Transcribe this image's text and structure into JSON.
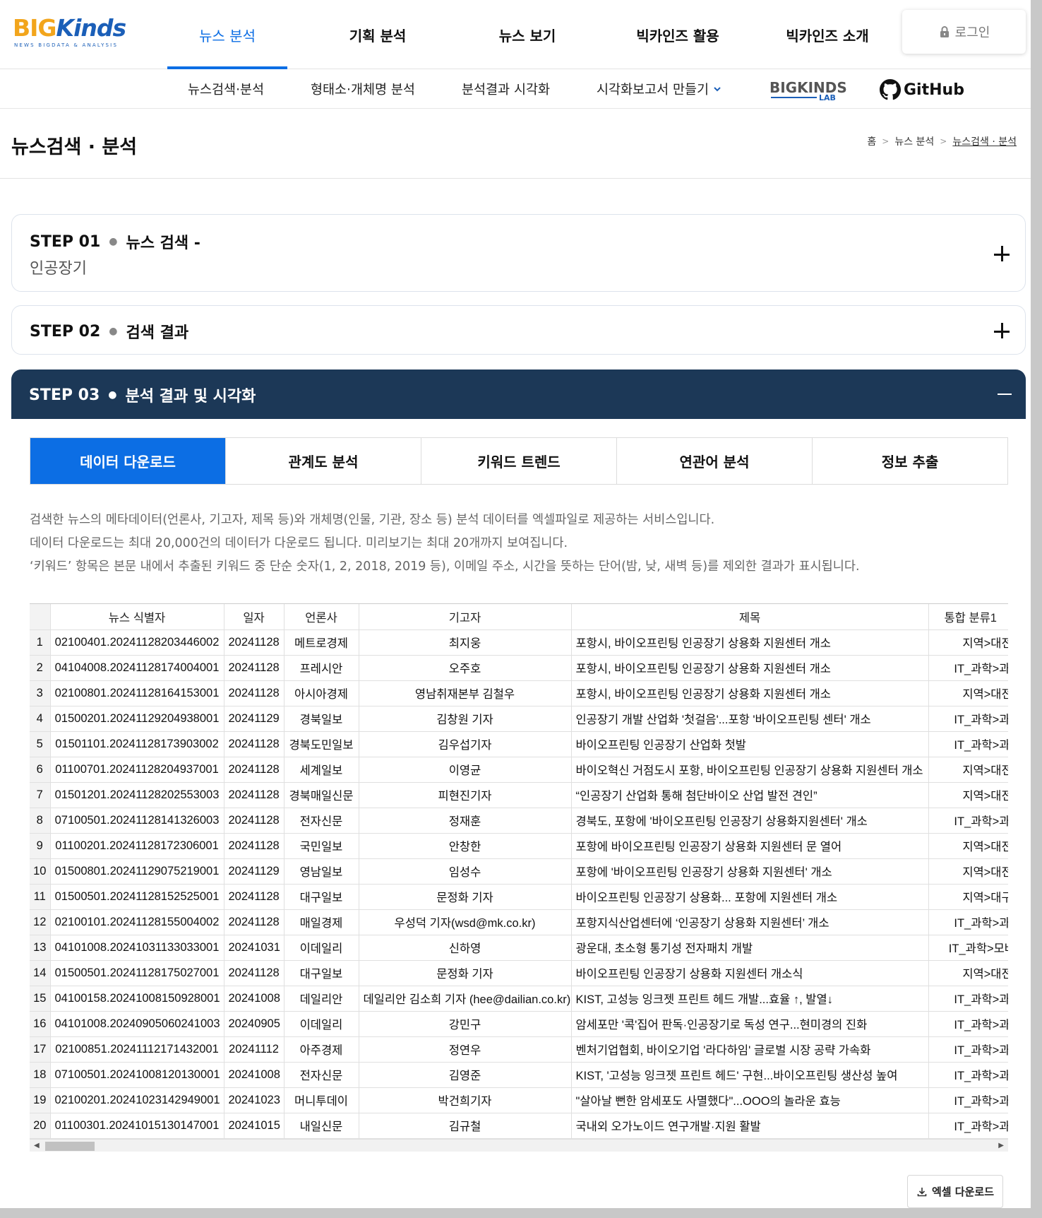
{
  "brand": {
    "logo_big": "BIG",
    "logo_kinds": "Kinds",
    "logo_sub": "NEWS BIGDATA & ANALYSIS"
  },
  "main_nav": [
    "뉴스 분석",
    "기획 분석",
    "뉴스 보기",
    "빅카인즈 활용",
    "빅카인즈 소개"
  ],
  "login_label": "로그인",
  "sub_nav": [
    "뉴스검색·분석",
    "형태소·개체명 분석",
    "분석결과 시각화",
    "시각화보고서 만들기"
  ],
  "lab_logo": {
    "text": "BIGKINDS",
    "lab": "LAB"
  },
  "github_label": "GitHub",
  "page_title": "뉴스검색 · 분석",
  "breadcrumb": [
    "홈",
    "뉴스 분석",
    "뉴스검색 · 분석"
  ],
  "steps": {
    "step1": {
      "num": "STEP 01",
      "title": "뉴스 검색 -",
      "query": "인공장기"
    },
    "step2": {
      "num": "STEP 02",
      "title": "검색 결과"
    },
    "step3": {
      "num": "STEP 03",
      "title": "분석 결과 및 시각화"
    }
  },
  "tabs": [
    "데이터 다운로드",
    "관계도 분석",
    "키워드 트렌드",
    "연관어 분석",
    "정보 추출"
  ],
  "description": [
    "검색한 뉴스의 메타데이터(언론사, 기고자, 제목 등)와 개체명(인물, 기관, 장소 등) 분석 데이터를 엑셀파일로 제공하는 서비스입니다.",
    "데이터 다운로드는 최대 20,000건의 데이터가 다운로드 됩니다. 미리보기는 최대 20개까지 보여집니다.",
    "‘키워드’ 항목은 본문 내에서 추출된 키워드 중 단순 숫자(1, 2, 2018, 2019 등), 이메일 주소, 시간을 뜻하는 단어(밤, 낮, 새벽 등)를 제외한 결과가 표시됩니다."
  ],
  "table": {
    "headers": [
      "",
      "뉴스 식별자",
      "일자",
      "언론사",
      "기고자",
      "제목",
      "통합 분류1"
    ],
    "rows": [
      [
        "1",
        "02100401.20241128203446002",
        "20241128",
        "메트로경제",
        "최지웅",
        "포항시, 바이오프린팅 인공장기 상용화 지원센터 개소",
        "지역>대전"
      ],
      [
        "2",
        "04104008.20241128174004001",
        "20241128",
        "프레시안",
        "오주호",
        "포항시, 바이오프린팅 인공장기 상용화 지원센터 개소",
        "IT_과학>과학"
      ],
      [
        "3",
        "02100801.20241128164153001",
        "20241128",
        "아시아경제",
        "영남취재본부 김철우",
        "포항시, 바이오프린팅 인공장기 상용화 지원센터 개소",
        "지역>대전"
      ],
      [
        "4",
        "01500201.20241129204938001",
        "20241129",
        "경북일보",
        "김창원 기자",
        "인공장기 개발 산업화 '첫걸음'...포항 '바이오프린팅 센터' 개소",
        "IT_과학>과학"
      ],
      [
        "5",
        "01501101.20241128173903002",
        "20241128",
        "경북도민일보",
        "김우섭기자",
        "바이오프린팅 인공장기 산업화 첫발",
        "IT_과학>과학"
      ],
      [
        "6",
        "01100701.20241128204937001",
        "20241128",
        "세계일보",
        "이영균",
        "바이오혁신 거점도시 포항, 바이오프린팅 인공장기 상용화 지원센터 개소",
        "지역>대전"
      ],
      [
        "7",
        "01501201.20241128202553003",
        "20241128",
        "경북매일신문",
        "피현진기자",
        "“인공장기 산업화 통해 첨단바이오 산업 발전 견인”",
        "지역>대전"
      ],
      [
        "8",
        "07100501.20241128141326003",
        "20241128",
        "전자신문",
        "정재훈",
        "경북도, 포항에 '바이오프린팅 인공장기 상용화지원센터' 개소",
        "IT_과학>과학"
      ],
      [
        "9",
        "01100201.20241128172306001",
        "20241128",
        "국민일보",
        "안창한",
        "포항에 바이오프린팅 인공장기 상용화 지원센터 문 열어",
        "지역>대전"
      ],
      [
        "10",
        "01500801.20241129075219001",
        "20241129",
        "영남일보",
        "임성수",
        "포항에 '바이오프린팅 인공장기 상용화 지원센터' 개소",
        "지역>대전"
      ],
      [
        "11",
        "01500501.20241128152525001",
        "20241128",
        "대구일보",
        "문정화 기자",
        "바이오프린팅 인공장기 상용화... 포항에 지원센터 개소",
        "지역>대구"
      ],
      [
        "12",
        "02100101.20241128155004002",
        "20241128",
        "매일경제",
        "우성덕 기자(wsd@mk.co.kr)",
        "포항지식산업센터에 ‘인공장기 상용화 지원센터’ 개소",
        "IT_과학>과학"
      ],
      [
        "13",
        "04101008.20241031133033001",
        "20241031",
        "이데일리",
        "신하영",
        "광운대, 초소형 통기성 전자패치 개발",
        "IT_과학>모바일"
      ],
      [
        "14",
        "01500501.20241128175027001",
        "20241128",
        "대구일보",
        "문정화 기자",
        "바이오프린팅 인공장기 상용화 지원센터 개소식",
        "지역>대전"
      ],
      [
        "15",
        "04100158.20241008150928001",
        "20241008",
        "데일리안",
        "데일리안 김소희 기자 (hee@dailian.co.kr)",
        "KIST, 고성능 잉크젯 프린트 헤드 개발...효율 ↑, 발열↓",
        "IT_과학>과학"
      ],
      [
        "16",
        "04101008.20240905060241003",
        "20240905",
        "이데일리",
        "강민구",
        "암세포만 '콕'집어 판독·인공장기로 독성 연구...현미경의 진화",
        "IT_과학>과학"
      ],
      [
        "17",
        "02100851.20241112171432001",
        "20241112",
        "아주경제",
        "정연우",
        "벤처기업협회, 바이오기업 '라다하임' 글로벌 시장 공략 가속화",
        "IT_과학>과학"
      ],
      [
        "18",
        "07100501.20241008120130001",
        "20241008",
        "전자신문",
        "김영준",
        "KIST, '고성능 잉크젯 프린트 헤드' 구현...바이오프린팅 생산성 높여",
        "IT_과학>과학"
      ],
      [
        "19",
        "02100201.20241023142949001",
        "20241023",
        "머니투데이",
        "박건희기자",
        "\"살아날 뻔한 암세포도 사멸했다\"...OOO의 놀라운 효능",
        "IT_과학>과학"
      ],
      [
        "20",
        "01100301.20241015130147001",
        "20241015",
        "내일신문",
        "김규철",
        "국내외 오가노이드 연구개발·지원 활발",
        "IT_과학>과학"
      ]
    ]
  },
  "excel_button": "엑셀 다운로드",
  "colors": {
    "accent": "#0c6ee4",
    "step3_bg": "#1c3857",
    "logo_orange": "#f2a51c",
    "logo_blue": "#1b5fb8"
  },
  "icons": {
    "login": "lock-icon",
    "dropdown": "chevron-down-icon",
    "github": "github-icon",
    "download": "download-icon",
    "expand": "plus-icon",
    "collapse": "minus-icon"
  }
}
